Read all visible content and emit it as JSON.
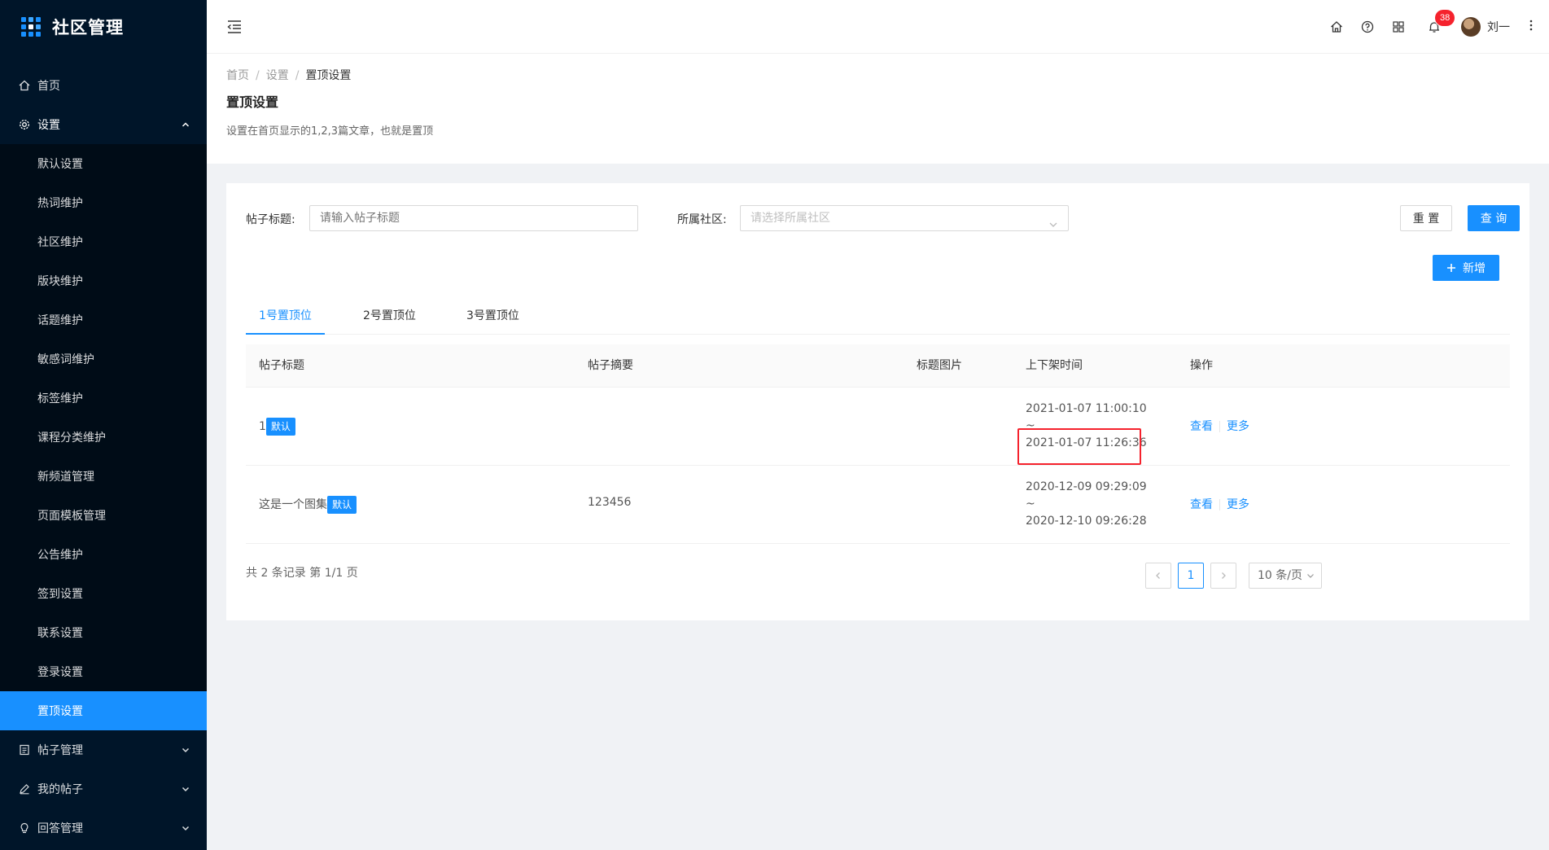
{
  "app": {
    "title": "社区管理"
  },
  "sidebar": {
    "items": [
      {
        "label": "首页",
        "icon": "home-icon"
      },
      {
        "label": "设置",
        "icon": "gear-icon"
      }
    ],
    "settings_sub": [
      {
        "label": "默认设置"
      },
      {
        "label": "热词维护"
      },
      {
        "label": "社区维护"
      },
      {
        "label": "版块维护"
      },
      {
        "label": "话题维护"
      },
      {
        "label": "敏感词维护"
      },
      {
        "label": "标签维护"
      },
      {
        "label": "课程分类维护"
      },
      {
        "label": "新频道管理"
      },
      {
        "label": "页面模板管理"
      },
      {
        "label": "公告维护"
      },
      {
        "label": "签到设置"
      },
      {
        "label": "联系设置"
      },
      {
        "label": "登录设置"
      },
      {
        "label": "置顶设置",
        "active": true
      }
    ],
    "bottom_items": [
      {
        "label": "帖子管理",
        "icon": "file-text-icon"
      },
      {
        "label": "我的帖子",
        "icon": "edit-icon"
      },
      {
        "label": "回答管理",
        "icon": "bulb-icon"
      }
    ]
  },
  "header": {
    "notification_count": "38",
    "username": "刘一"
  },
  "page": {
    "breadcrumb": [
      "首页",
      "设置",
      "置顶设置"
    ],
    "title": "置顶设置",
    "description": "设置在首页显示的1,2,3篇文章，也就是置顶"
  },
  "filters": {
    "title_label": "帖子标题:",
    "title_placeholder": "请输入帖子标题",
    "community_label": "所属社区:",
    "community_placeholder": "请选择所属社区",
    "reset_label": "重 置",
    "query_label": "查 询",
    "add_label": "新增"
  },
  "tabs": [
    {
      "label": "1号置顶位",
      "active": true
    },
    {
      "label": "2号置顶位"
    },
    {
      "label": "3号置顶位"
    }
  ],
  "table": {
    "columns": [
      "帖子标题",
      "帖子摘要",
      "标题图片",
      "上下架时间",
      "操作"
    ],
    "rows": [
      {
        "title": "1",
        "tag": "默认",
        "summary": "",
        "time_start": "2021-01-07 11:00:10",
        "tilde": "~",
        "time_end": "2021-01-07 11:26:36",
        "view": "查看",
        "more": "更多"
      },
      {
        "title": "这是一个图集",
        "tag": "默认",
        "summary": "123456",
        "time_start": "2020-12-09 09:29:09",
        "tilde": "~",
        "time_end": "2020-12-10 09:26:28",
        "view": "查看",
        "more": "更多"
      }
    ]
  },
  "pagination": {
    "summary": "共 2 条记录 第 1/1 页",
    "current_page": "1",
    "page_size": "10 条/页"
  }
}
